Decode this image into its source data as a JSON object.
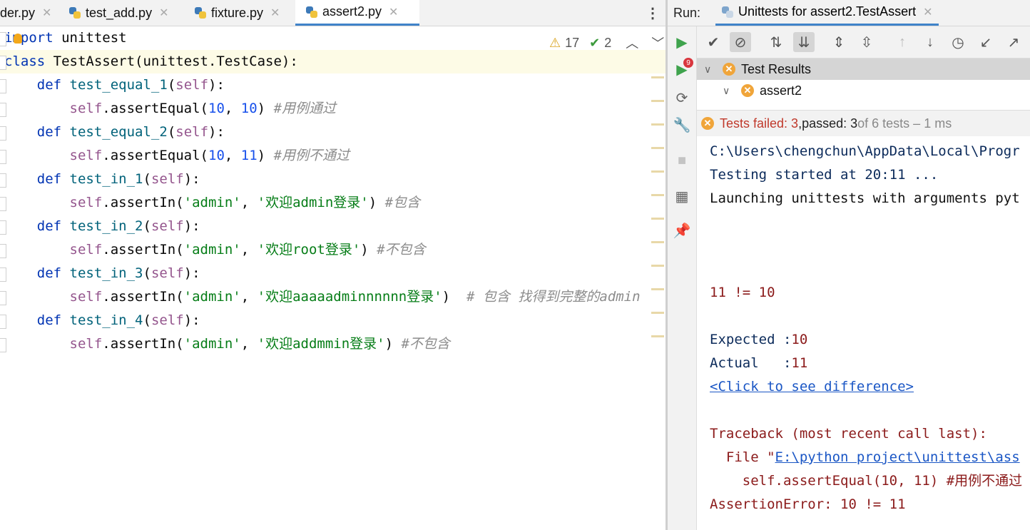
{
  "editor": {
    "tabs": [
      {
        "label": "der.py",
        "active": false
      },
      {
        "label": "test_add.py",
        "active": false
      },
      {
        "label": "fixture.py",
        "active": false
      },
      {
        "label": "assert2.py",
        "active": true
      }
    ],
    "more_label": "⋮",
    "inspection": {
      "warnings": "17",
      "weak_warnings": "2"
    },
    "lines": [
      {
        "tokens": [
          {
            "t": "kw",
            "v": "import"
          },
          {
            "t": "tx",
            "v": " unittest"
          }
        ]
      },
      {
        "tokens": [
          {
            "t": "kw",
            "v": "class"
          },
          {
            "t": "tx",
            "v": " TestAssert(unittest.TestCase):"
          }
        ]
      },
      {
        "tokens": [
          {
            "t": "tx",
            "v": "    "
          },
          {
            "t": "kw",
            "v": "def"
          },
          {
            "t": "tx",
            "v": " "
          },
          {
            "t": "fn",
            "v": "test_equal_1"
          },
          {
            "t": "tx",
            "v": "("
          },
          {
            "t": "self",
            "v": "self"
          },
          {
            "t": "tx",
            "v": "):"
          }
        ]
      },
      {
        "tokens": [
          {
            "t": "tx",
            "v": "        "
          },
          {
            "t": "self",
            "v": "self"
          },
          {
            "t": "tx",
            "v": ".assertEqual("
          },
          {
            "t": "num",
            "v": "10"
          },
          {
            "t": "tx",
            "v": ", "
          },
          {
            "t": "num",
            "v": "10"
          },
          {
            "t": "tx",
            "v": ") "
          },
          {
            "t": "cm",
            "v": "#用例通过"
          }
        ]
      },
      {
        "tokens": [
          {
            "t": "tx",
            "v": "    "
          },
          {
            "t": "kw",
            "v": "def"
          },
          {
            "t": "tx",
            "v": " "
          },
          {
            "t": "fn",
            "v": "test_equal_2"
          },
          {
            "t": "tx",
            "v": "("
          },
          {
            "t": "self",
            "v": "self"
          },
          {
            "t": "tx",
            "v": "):"
          }
        ]
      },
      {
        "tokens": [
          {
            "t": "tx",
            "v": "        "
          },
          {
            "t": "self",
            "v": "self"
          },
          {
            "t": "tx",
            "v": ".assertEqual("
          },
          {
            "t": "num",
            "v": "10"
          },
          {
            "t": "tx",
            "v": ", "
          },
          {
            "t": "num",
            "v": "11"
          },
          {
            "t": "tx",
            "v": ") "
          },
          {
            "t": "cm",
            "v": "#用例不通过"
          }
        ]
      },
      {
        "tokens": [
          {
            "t": "tx",
            "v": "    "
          },
          {
            "t": "kw",
            "v": "def"
          },
          {
            "t": "tx",
            "v": " "
          },
          {
            "t": "fn",
            "v": "test_in_1"
          },
          {
            "t": "tx",
            "v": "("
          },
          {
            "t": "self",
            "v": "self"
          },
          {
            "t": "tx",
            "v": "):"
          }
        ]
      },
      {
        "tokens": [
          {
            "t": "tx",
            "v": "        "
          },
          {
            "t": "self",
            "v": "self"
          },
          {
            "t": "tx",
            "v": ".assertIn("
          },
          {
            "t": "str",
            "v": "'admin'"
          },
          {
            "t": "tx",
            "v": ", "
          },
          {
            "t": "str",
            "v": "'欢迎admin登录'"
          },
          {
            "t": "tx",
            "v": ") "
          },
          {
            "t": "cm",
            "v": "#包含"
          }
        ]
      },
      {
        "tokens": [
          {
            "t": "tx",
            "v": "    "
          },
          {
            "t": "kw",
            "v": "def"
          },
          {
            "t": "tx",
            "v": " "
          },
          {
            "t": "fn",
            "v": "test_in_2"
          },
          {
            "t": "tx",
            "v": "("
          },
          {
            "t": "self",
            "v": "self"
          },
          {
            "t": "tx",
            "v": "):"
          }
        ]
      },
      {
        "tokens": [
          {
            "t": "tx",
            "v": "        "
          },
          {
            "t": "self",
            "v": "self"
          },
          {
            "t": "tx",
            "v": ".assertIn("
          },
          {
            "t": "str",
            "v": "'admin'"
          },
          {
            "t": "tx",
            "v": ", "
          },
          {
            "t": "str",
            "v": "'欢迎root登录'"
          },
          {
            "t": "tx",
            "v": ") "
          },
          {
            "t": "cm",
            "v": "#不包含"
          }
        ]
      },
      {
        "tokens": [
          {
            "t": "tx",
            "v": "    "
          },
          {
            "t": "kw",
            "v": "def"
          },
          {
            "t": "tx",
            "v": " "
          },
          {
            "t": "fn",
            "v": "test_in_3"
          },
          {
            "t": "tx",
            "v": "("
          },
          {
            "t": "self",
            "v": "self"
          },
          {
            "t": "tx",
            "v": "):"
          }
        ]
      },
      {
        "tokens": [
          {
            "t": "tx",
            "v": "        "
          },
          {
            "t": "self",
            "v": "self"
          },
          {
            "t": "tx",
            "v": ".assertIn("
          },
          {
            "t": "str",
            "v": "'admin'"
          },
          {
            "t": "tx",
            "v": ", "
          },
          {
            "t": "str",
            "v": "'欢迎aaaaadminnnnnn登录'"
          },
          {
            "t": "tx",
            "v": ")  "
          },
          {
            "t": "cm",
            "v": "# 包含 找得到完整的admin"
          }
        ]
      },
      {
        "tokens": [
          {
            "t": "tx",
            "v": "    "
          },
          {
            "t": "kw",
            "v": "def"
          },
          {
            "t": "tx",
            "v": " "
          },
          {
            "t": "fn",
            "v": "test_in_4"
          },
          {
            "t": "tx",
            "v": "("
          },
          {
            "t": "self",
            "v": "self"
          },
          {
            "t": "tx",
            "v": "):"
          }
        ]
      },
      {
        "tokens": [
          {
            "t": "tx",
            "v": "        "
          },
          {
            "t": "self",
            "v": "self"
          },
          {
            "t": "tx",
            "v": ".assertIn("
          },
          {
            "t": "str",
            "v": "'admin'"
          },
          {
            "t": "tx",
            "v": ", "
          },
          {
            "t": "str",
            "v": "'欢迎addmmin登录'"
          },
          {
            "t": "tx",
            "v": ") "
          },
          {
            "t": "cm",
            "v": "#不包含"
          }
        ]
      }
    ]
  },
  "run": {
    "label": "Run:",
    "tab_label": "Unittests for assert2.TestAssert",
    "tree": {
      "root": "Test Results",
      "child": "assert2"
    },
    "status": {
      "failed": "Tests failed: 3",
      "sep": ", ",
      "passed": "passed: 3",
      "rest": " of 6 tests – 1 ms"
    },
    "console": [
      {
        "text": "C:\\Users\\chengchun\\AppData\\Local\\Progr",
        "style": "blue"
      },
      {
        "text": "Testing started at 20:11 ...",
        "style": "blue"
      },
      {
        "text": "Launching unittests with arguments pyt",
        "style": "dark"
      },
      {
        "text": "",
        "style": "dark"
      },
      {
        "text": "",
        "style": "dark"
      },
      {
        "text": "",
        "style": "dark"
      },
      {
        "text": "11 != 10",
        "style": "red"
      },
      {
        "text": "",
        "style": "dark"
      },
      {
        "text": "Expected :10",
        "style": "mixed",
        "a": "Expected :",
        "b": "10"
      },
      {
        "text": "Actual   :11",
        "style": "mixed",
        "a": "Actual   :",
        "b": "11"
      },
      {
        "text": "<Click to see difference>",
        "style": "link"
      },
      {
        "text": "",
        "style": "dark"
      },
      {
        "text": "Traceback (most recent call last):",
        "style": "red"
      },
      {
        "text": "  File \"",
        "style": "file",
        "link": "E:\\python project\\unittest\\ass"
      },
      {
        "text": "    self.assertEqual(10, 11) #用例不通过",
        "style": "red"
      },
      {
        "text": "AssertionError: 10 != 11",
        "style": "red"
      }
    ]
  }
}
